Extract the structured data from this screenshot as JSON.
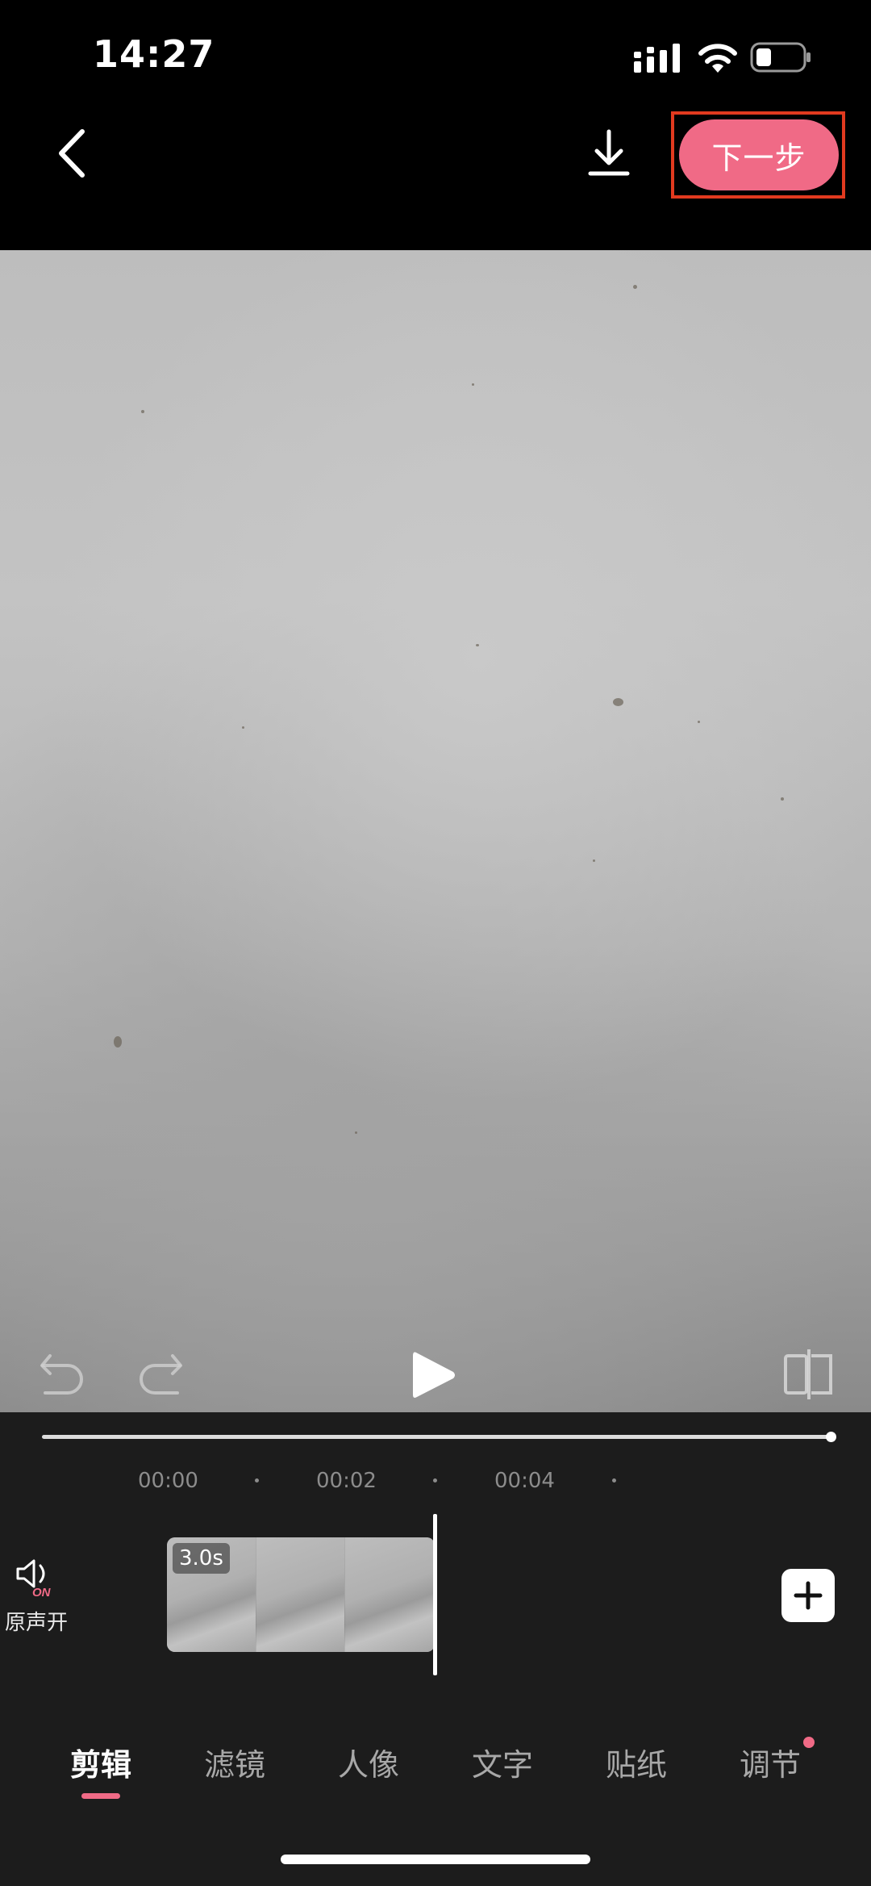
{
  "status_bar": {
    "time": "14:27"
  },
  "top_nav": {
    "next_label": "下一步"
  },
  "timeline": {
    "ticks": [
      "00:00",
      "00:02",
      "00:04"
    ],
    "clip_duration": "3.0s",
    "audio_label": "原声开",
    "audio_badge": "ON"
  },
  "tabs": [
    {
      "label": "剪辑",
      "active": true
    },
    {
      "label": "滤镜",
      "active": false
    },
    {
      "label": "人像",
      "active": false
    },
    {
      "label": "文字",
      "active": false
    },
    {
      "label": "贴纸",
      "active": false
    },
    {
      "label": "调节",
      "active": false,
      "badge": true
    }
  ],
  "colors": {
    "accent": "#f06a86",
    "highlight": "#e23a1f",
    "panel": "#1c1c1c"
  }
}
